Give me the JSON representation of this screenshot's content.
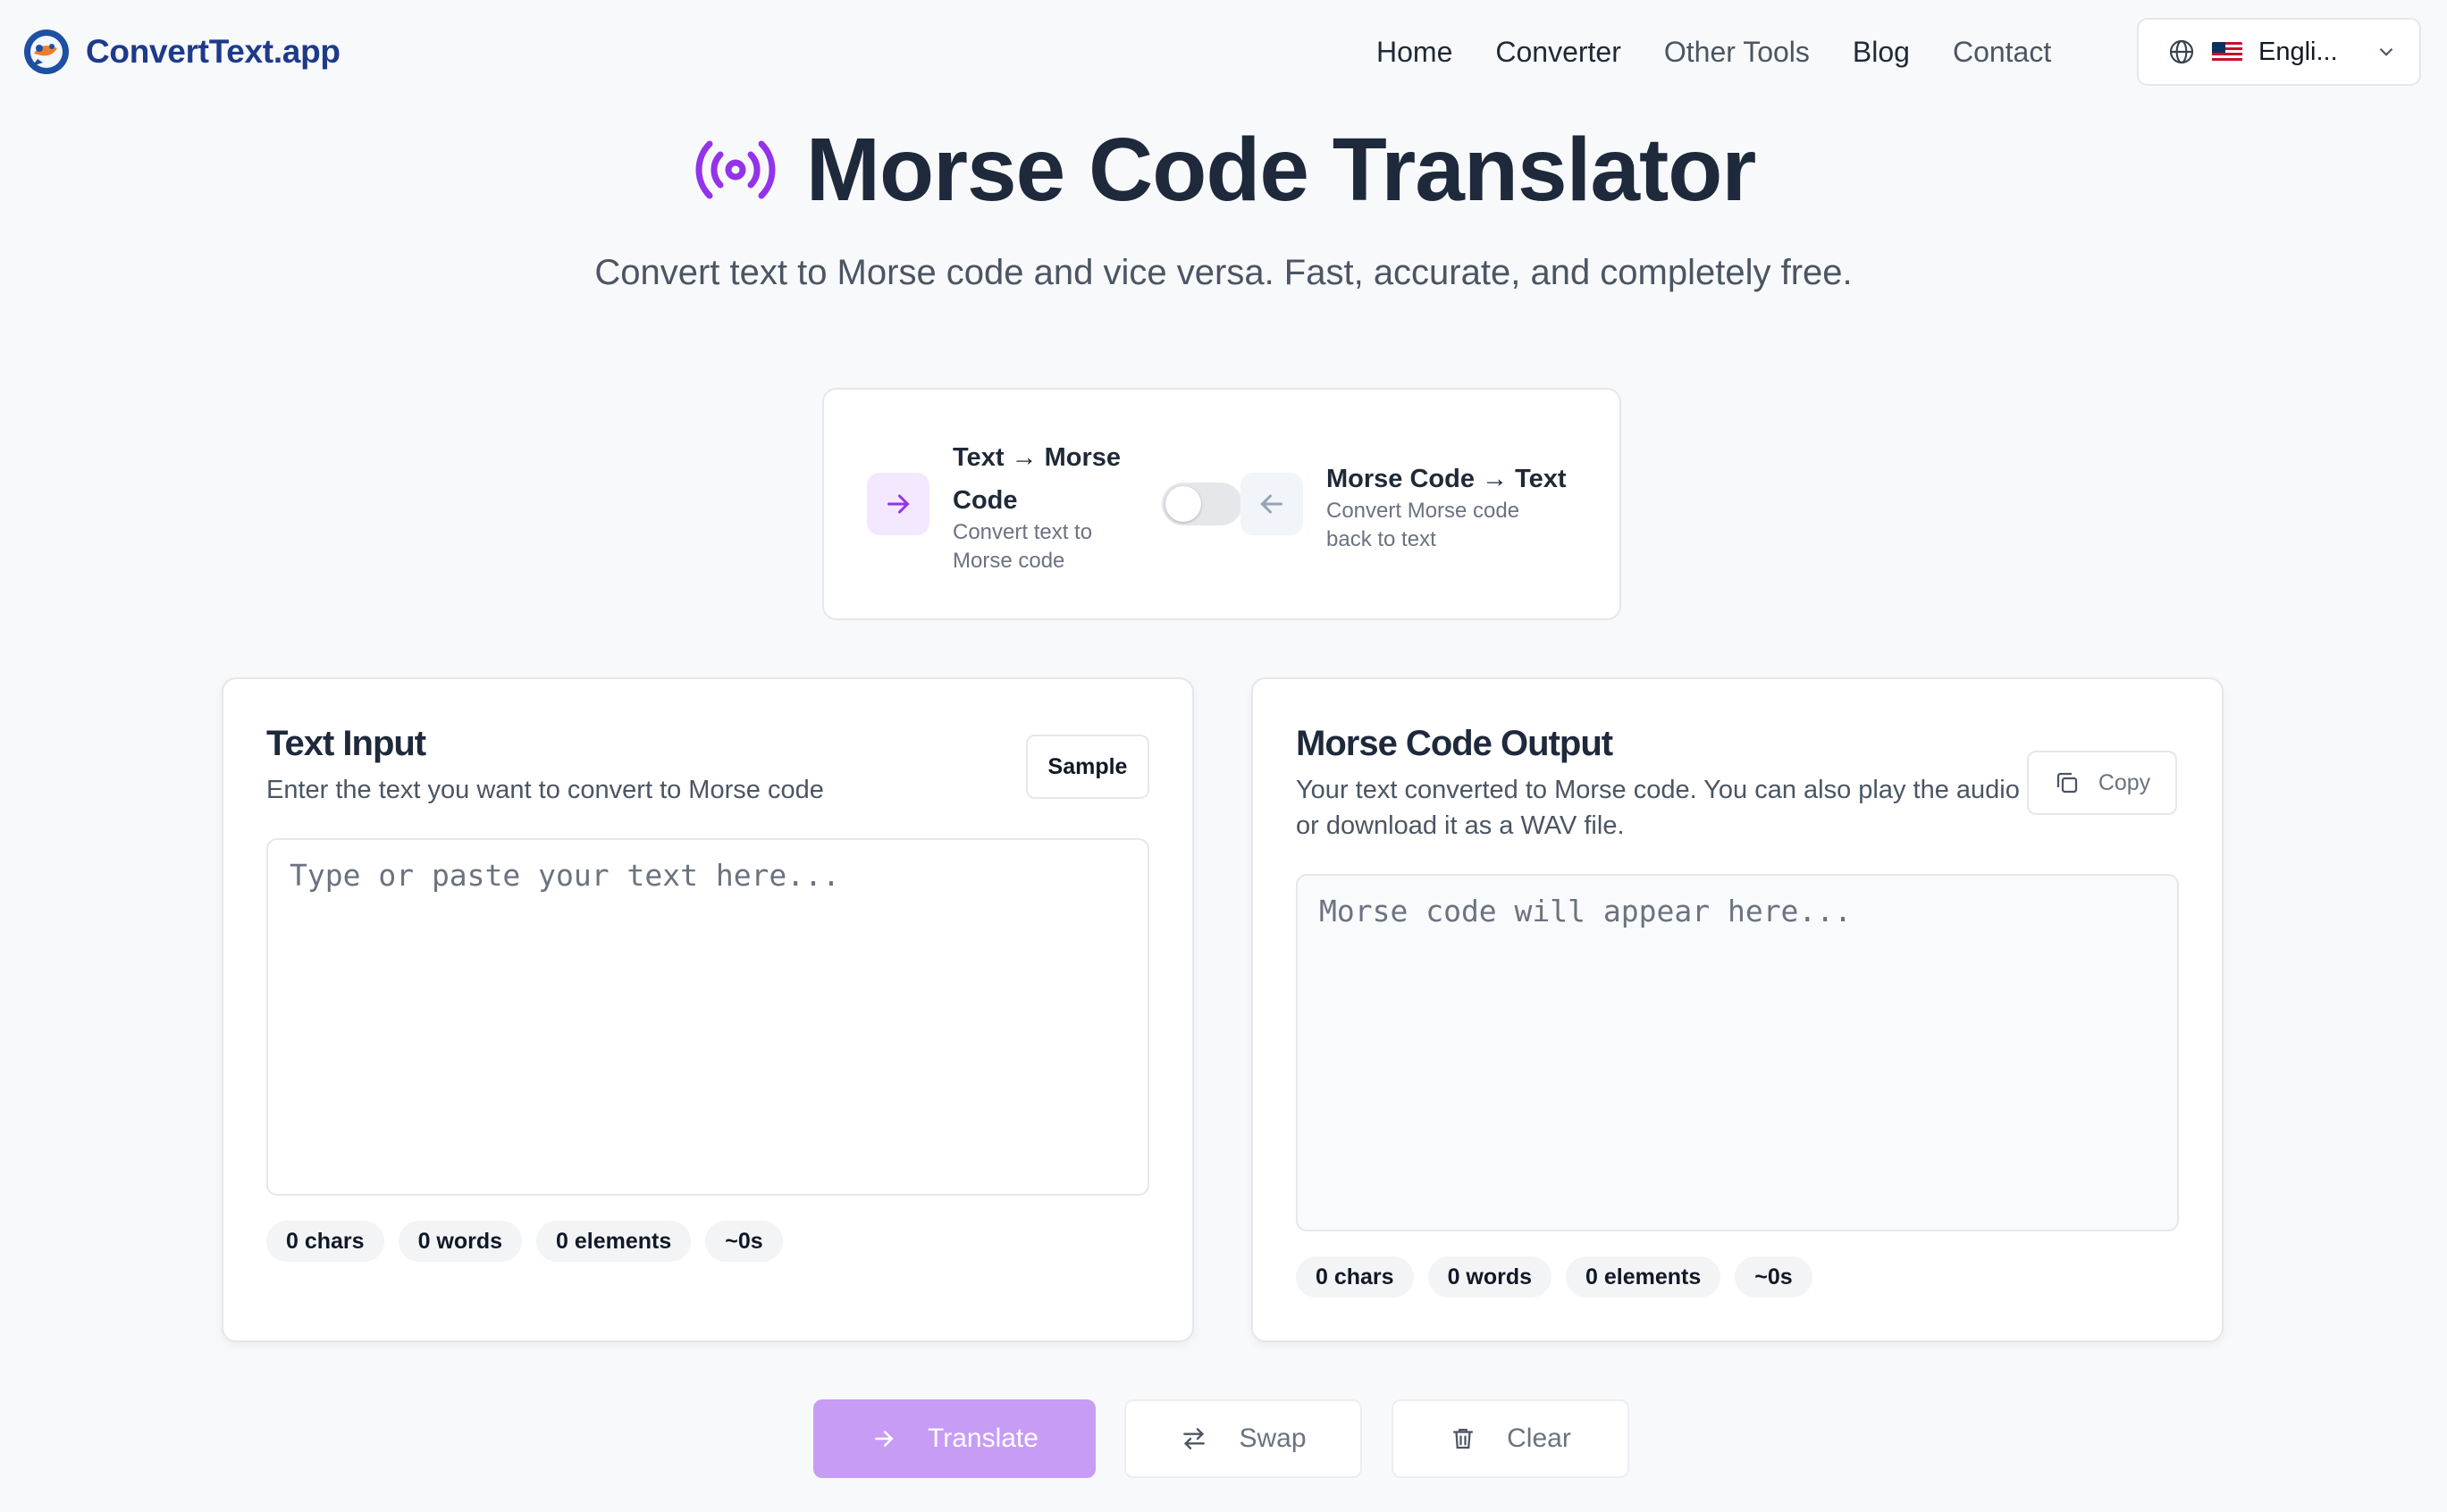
{
  "brand": {
    "name": "ConvertText.app"
  },
  "nav": {
    "links": [
      "Home",
      "Converter",
      "Other Tools",
      "Blog",
      "Contact"
    ],
    "language": {
      "flag": "🇺🇸",
      "label": "Engli..."
    }
  },
  "hero": {
    "title": "Morse Code Translator",
    "subtitle": "Convert text to Morse code and vice versa. Fast, accurate, and completely free.",
    "icon": "broadcast-icon",
    "accent": "#9333ea"
  },
  "mode": {
    "left": {
      "title_line1": "Text → Morse",
      "title_line2": "Code",
      "desc_line1": "Convert text to",
      "desc_line2": "Morse code",
      "icon": "arrow-right-icon"
    },
    "right": {
      "title": "Morse Code → Text",
      "desc_line1": "Convert Morse code",
      "desc_line2": "back to text",
      "icon": "arrow-left-icon"
    },
    "toggle_on": false
  },
  "input_panel": {
    "title": "Text Input",
    "description": "Enter the text you want to convert to Morse code",
    "sample_label": "Sample",
    "placeholder": "Type or paste your text here...",
    "value": "",
    "stats": [
      "0 chars",
      "0 words",
      "0 elements",
      "~0s"
    ]
  },
  "output_panel": {
    "title": "Morse Code Output",
    "description_line1": "Your text converted to Morse code. You can also play the audio",
    "description_line2": "or download it as a WAV file.",
    "copy_label": "Copy",
    "placeholder": "Morse code will appear here...",
    "value": "",
    "stats": [
      "0 chars",
      "0 words",
      "0 elements",
      "~0s"
    ]
  },
  "actions": {
    "translate": "Translate",
    "swap": "Swap",
    "clear": "Clear"
  },
  "colors": {
    "primary": "#c79cf5",
    "brand_text": "#1e3a8a",
    "muted": "#6b7280"
  }
}
